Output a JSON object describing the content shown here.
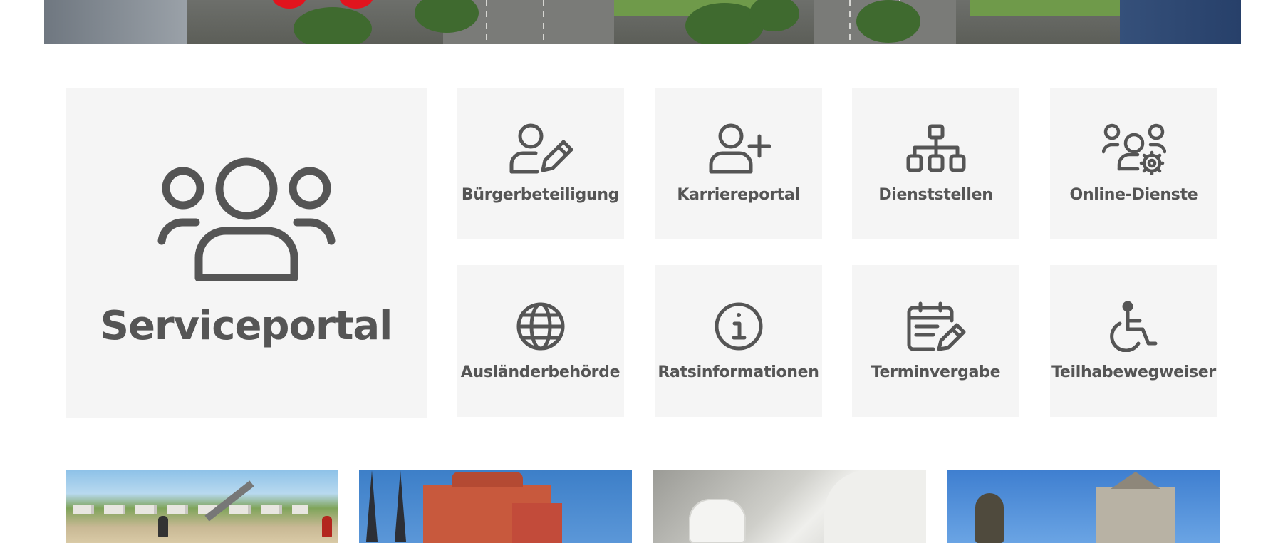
{
  "hero": {
    "brand_color": "#e1141e"
  },
  "serviceportal": {
    "label": "Serviceportal",
    "icon": "group-icon"
  },
  "tiles": [
    {
      "label": "Bürgerbeteiligung",
      "icon": "user-pencil-icon"
    },
    {
      "label": "Karriereportal",
      "icon": "user-plus-icon"
    },
    {
      "label": "Dienststellen",
      "icon": "org-chart-icon"
    },
    {
      "label": "Online-Dienste",
      "icon": "users-gear-icon"
    },
    {
      "label": "Ausländerbehörde",
      "icon": "globe-icon"
    },
    {
      "label": "Ratsinformationen",
      "icon": "info-circle-icon"
    },
    {
      "label": "Terminvergabe",
      "icon": "calendar-pencil-icon"
    },
    {
      "label": "Teilhabewegweiser",
      "icon": "wheelchair-icon"
    }
  ],
  "colors": {
    "tile_background": "#f5f5f5",
    "icon_and_text": "#555555"
  }
}
